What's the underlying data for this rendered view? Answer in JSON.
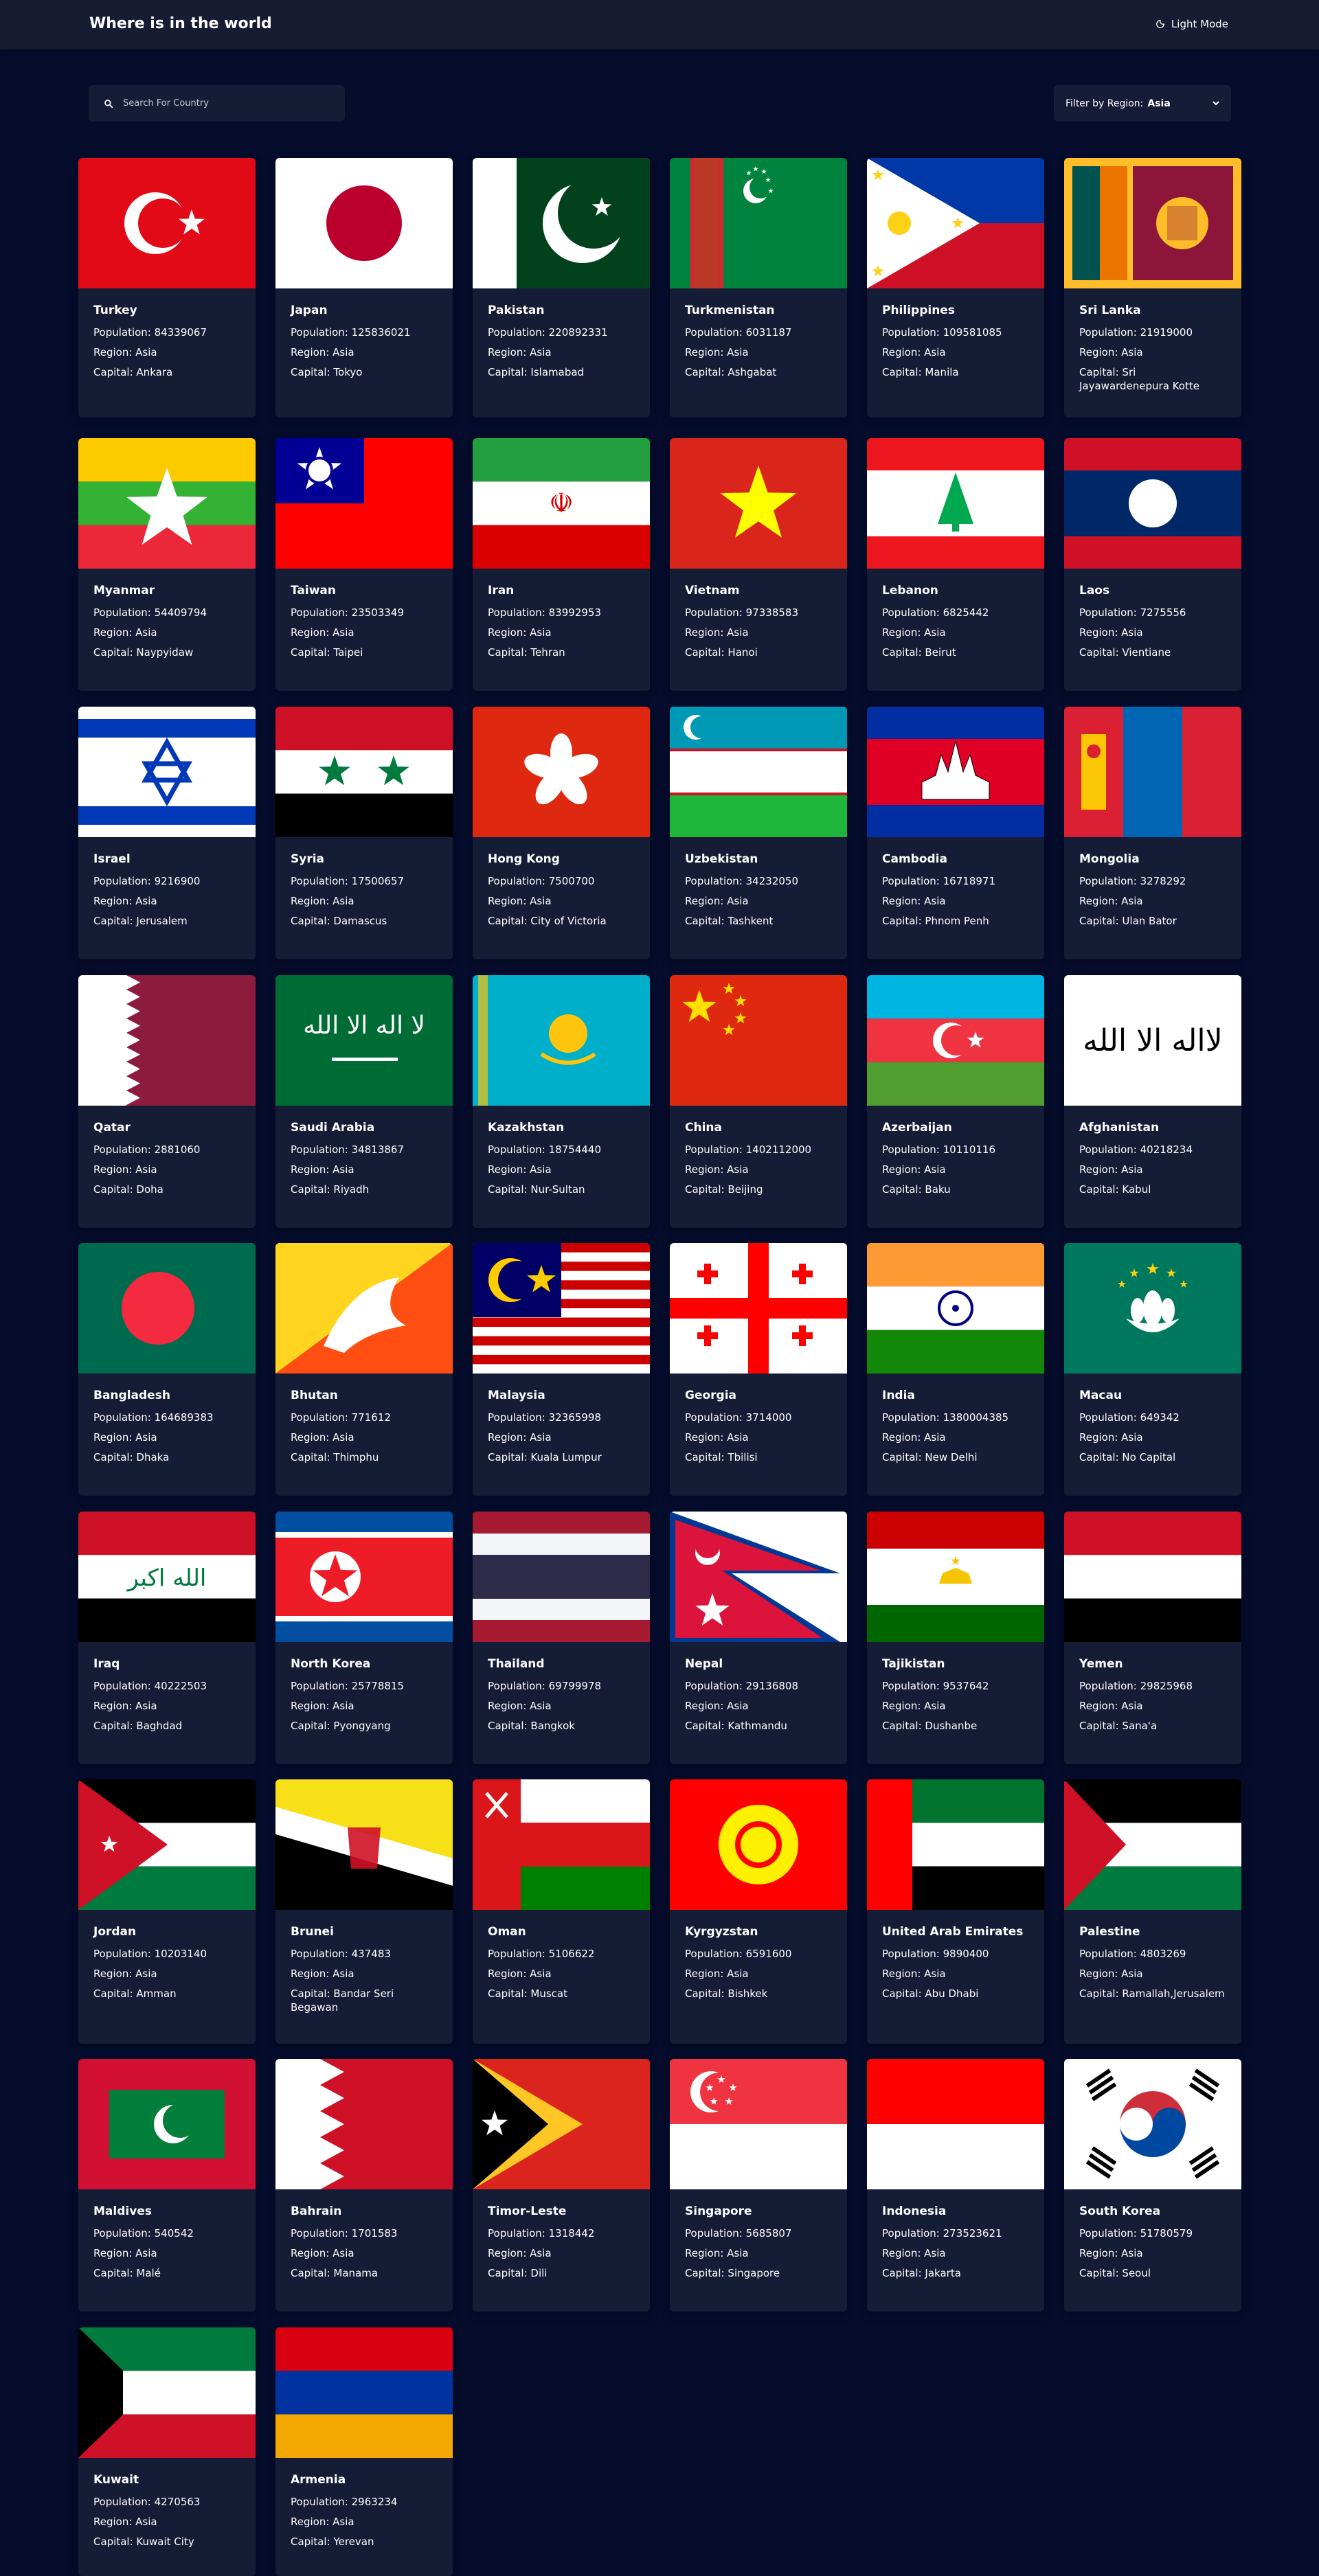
{
  "header": {
    "title": "Where is in the world",
    "mode_label": "Light Mode",
    "mode_icon": "moon-icon"
  },
  "search": {
    "placeholder": "Search For Country",
    "value": ""
  },
  "filter": {
    "label": "Filter by Region:",
    "value": "Asia"
  },
  "labels": {
    "population": "Population: ",
    "region": "Region: ",
    "capital": "Capital: "
  },
  "countries": [
    {
      "name": "Turkey",
      "population": "84339067",
      "region": "Asia",
      "capital": "Ankara"
    },
    {
      "name": "Japan",
      "population": "125836021",
      "region": "Asia",
      "capital": "Tokyo"
    },
    {
      "name": "Pakistan",
      "population": "220892331",
      "region": "Asia",
      "capital": "Islamabad"
    },
    {
      "name": "Turkmenistan",
      "population": "6031187",
      "region": "Asia",
      "capital": "Ashgabat"
    },
    {
      "name": "Philippines",
      "population": "109581085",
      "region": "Asia",
      "capital": "Manila"
    },
    {
      "name": "Sri Lanka",
      "population": "21919000",
      "region": "Asia",
      "capital": "Sri Jayawardenepura Kotte"
    },
    {
      "name": "Myanmar",
      "population": "54409794",
      "region": "Asia",
      "capital": "Naypyidaw"
    },
    {
      "name": "Taiwan",
      "population": "23503349",
      "region": "Asia",
      "capital": "Taipei"
    },
    {
      "name": "Iran",
      "population": "83992953",
      "region": "Asia",
      "capital": "Tehran"
    },
    {
      "name": "Vietnam",
      "population": "97338583",
      "region": "Asia",
      "capital": "Hanoi"
    },
    {
      "name": "Lebanon",
      "population": "6825442",
      "region": "Asia",
      "capital": "Beirut"
    },
    {
      "name": "Laos",
      "population": "7275556",
      "region": "Asia",
      "capital": "Vientiane"
    },
    {
      "name": "Israel",
      "population": "9216900",
      "region": "Asia",
      "capital": "Jerusalem"
    },
    {
      "name": "Syria",
      "population": "17500657",
      "region": "Asia",
      "capital": "Damascus"
    },
    {
      "name": "Hong Kong",
      "population": "7500700",
      "region": "Asia",
      "capital": "City of Victoria"
    },
    {
      "name": "Uzbekistan",
      "population": "34232050",
      "region": "Asia",
      "capital": "Tashkent"
    },
    {
      "name": "Cambodia",
      "population": "16718971",
      "region": "Asia",
      "capital": "Phnom Penh"
    },
    {
      "name": "Mongolia",
      "population": "3278292",
      "region": "Asia",
      "capital": "Ulan Bator"
    },
    {
      "name": "Qatar",
      "population": "2881060",
      "region": "Asia",
      "capital": "Doha"
    },
    {
      "name": "Saudi Arabia",
      "population": "34813867",
      "region": "Asia",
      "capital": "Riyadh"
    },
    {
      "name": "Kazakhstan",
      "population": "18754440",
      "region": "Asia",
      "capital": "Nur-Sultan"
    },
    {
      "name": "China",
      "population": "1402112000",
      "region": "Asia",
      "capital": "Beijing"
    },
    {
      "name": "Azerbaijan",
      "population": "10110116",
      "region": "Asia",
      "capital": "Baku"
    },
    {
      "name": "Afghanistan",
      "population": "40218234",
      "region": "Asia",
      "capital": "Kabul"
    },
    {
      "name": "Bangladesh",
      "population": "164689383",
      "region": "Asia",
      "capital": "Dhaka"
    },
    {
      "name": "Bhutan",
      "population": "771612",
      "region": "Asia",
      "capital": "Thimphu"
    },
    {
      "name": "Malaysia",
      "population": "32365998",
      "region": "Asia",
      "capital": "Kuala Lumpur"
    },
    {
      "name": "Georgia",
      "population": "3714000",
      "region": "Asia",
      "capital": "Tbilisi"
    },
    {
      "name": "India",
      "population": "1380004385",
      "region": "Asia",
      "capital": "New Delhi"
    },
    {
      "name": "Macau",
      "population": "649342",
      "region": "Asia",
      "capital": "No Capital"
    },
    {
      "name": "Iraq",
      "population": "40222503",
      "region": "Asia",
      "capital": "Baghdad"
    },
    {
      "name": "North Korea",
      "population": "25778815",
      "region": "Asia",
      "capital": "Pyongyang"
    },
    {
      "name": "Thailand",
      "population": "69799978",
      "region": "Asia",
      "capital": "Bangkok"
    },
    {
      "name": "Nepal",
      "population": "29136808",
      "region": "Asia",
      "capital": "Kathmandu"
    },
    {
      "name": "Tajikistan",
      "population": "9537642",
      "region": "Asia",
      "capital": "Dushanbe"
    },
    {
      "name": "Yemen",
      "population": "29825968",
      "region": "Asia",
      "capital": "Sana'a"
    },
    {
      "name": "Jordan",
      "population": "10203140",
      "region": "Asia",
      "capital": "Amman"
    },
    {
      "name": "Brunei",
      "population": "437483",
      "region": "Asia",
      "capital": "Bandar Seri Begawan"
    },
    {
      "name": "Oman",
      "population": "5106622",
      "region": "Asia",
      "capital": "Muscat"
    },
    {
      "name": "Kyrgyzstan",
      "population": "6591600",
      "region": "Asia",
      "capital": "Bishkek"
    },
    {
      "name": "United Arab Emirates",
      "population": "9890400",
      "region": "Asia",
      "capital": "Abu Dhabi"
    },
    {
      "name": "Palestine",
      "population": "4803269",
      "region": "Asia",
      "capital": "Ramallah,Jerusalem"
    },
    {
      "name": "Maldives",
      "population": "540542",
      "region": "Asia",
      "capital": "Malé"
    },
    {
      "name": "Bahrain",
      "population": "1701583",
      "region": "Asia",
      "capital": "Manama"
    },
    {
      "name": "Timor-Leste",
      "population": "1318442",
      "region": "Asia",
      "capital": "Dili"
    },
    {
      "name": "Singapore",
      "population": "5685807",
      "region": "Asia",
      "capital": "Singapore"
    },
    {
      "name": "Indonesia",
      "population": "273523621",
      "region": "Asia",
      "capital": "Jakarta"
    },
    {
      "name": "South Korea",
      "population": "51780579",
      "region": "Asia",
      "capital": "Seoul"
    },
    {
      "name": "Kuwait",
      "population": "4270563",
      "region": "Asia",
      "capital": "Kuwait City"
    },
    {
      "name": "Armenia",
      "population": "2963234",
      "region": "Asia",
      "capital": "Yerevan"
    }
  ]
}
